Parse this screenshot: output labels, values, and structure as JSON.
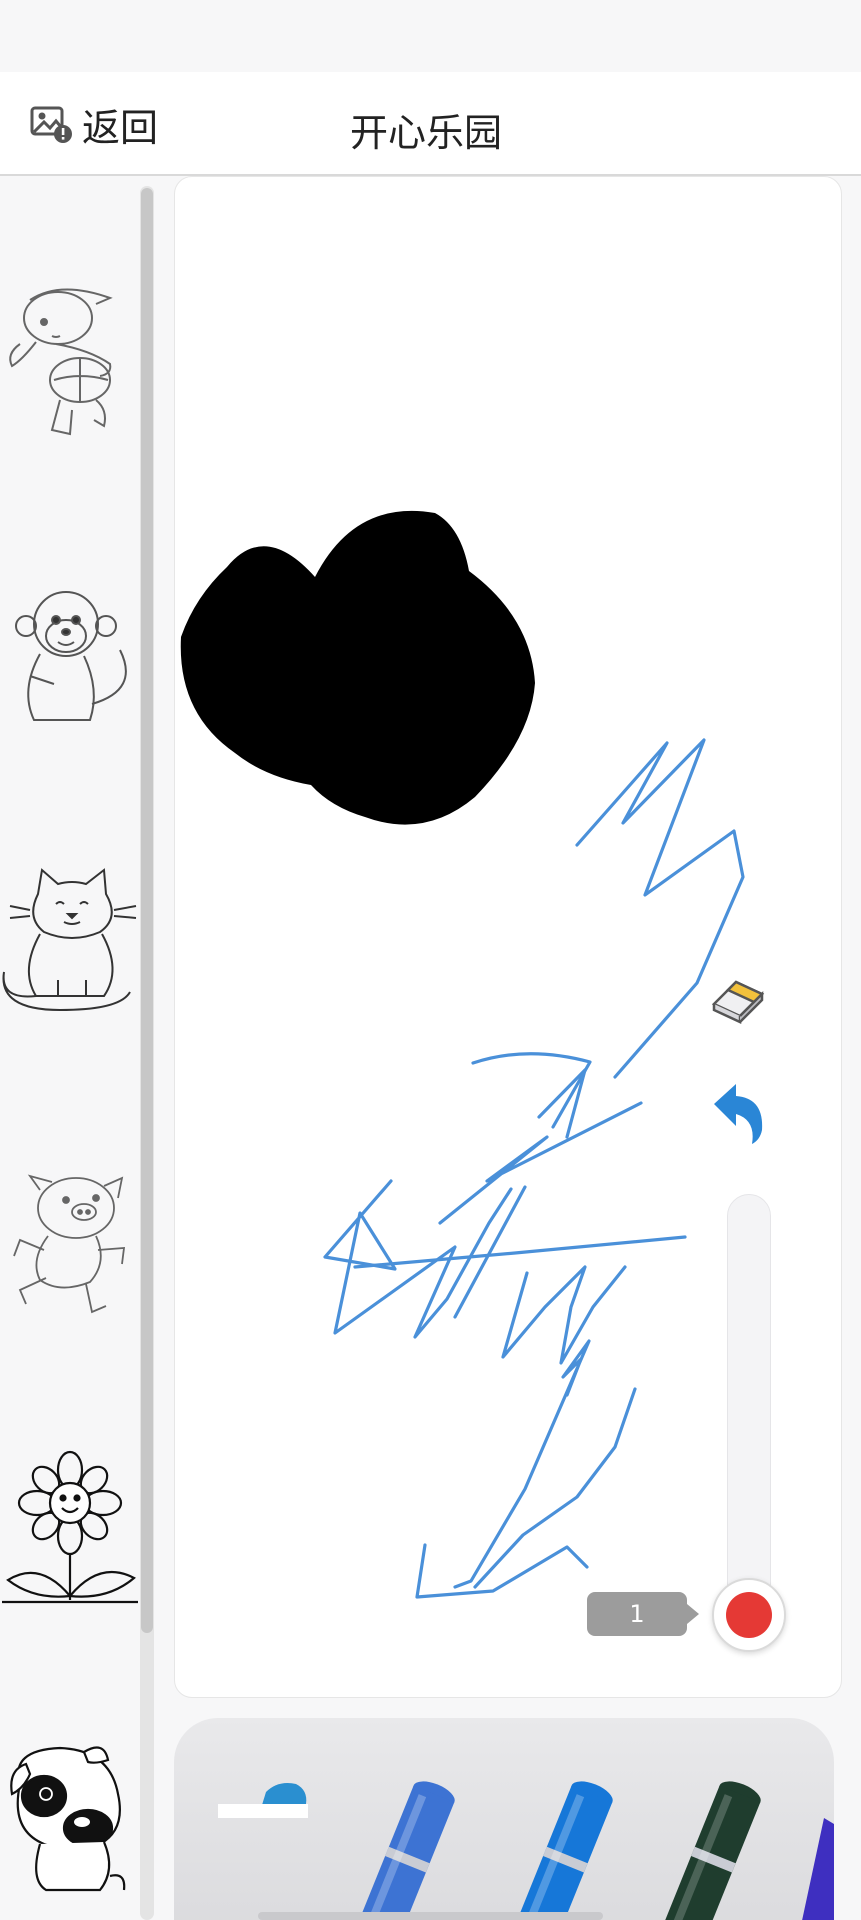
{
  "header": {
    "back_label": "返回",
    "title": "开心乐园"
  },
  "thumbnails": [
    {
      "icon": "boy-with-ball-icon"
    },
    {
      "icon": "monkey-icon"
    },
    {
      "icon": "cat-icon"
    },
    {
      "icon": "pig-icon"
    },
    {
      "icon": "flower-icon"
    },
    {
      "icon": "puppy-icon"
    }
  ],
  "tools": {
    "eraser_icon": "eraser-icon",
    "undo_icon": "undo-icon",
    "undo_color": "#2a86d6",
    "brush_size": "1",
    "current_color": "#e53935"
  },
  "canvas": {
    "fill_color": "#000000",
    "stroke_color": "#4a90d9"
  },
  "palette": {
    "pencils": [
      {
        "color": "#2a8fd0",
        "name": "light-blue"
      },
      {
        "color": "#3d73d3",
        "name": "royal-blue"
      },
      {
        "color": "#1677d8",
        "name": "blue"
      },
      {
        "color": "#1f3d2e",
        "name": "dark-green"
      },
      {
        "color": "#3e2fc0",
        "name": "indigo"
      }
    ]
  }
}
